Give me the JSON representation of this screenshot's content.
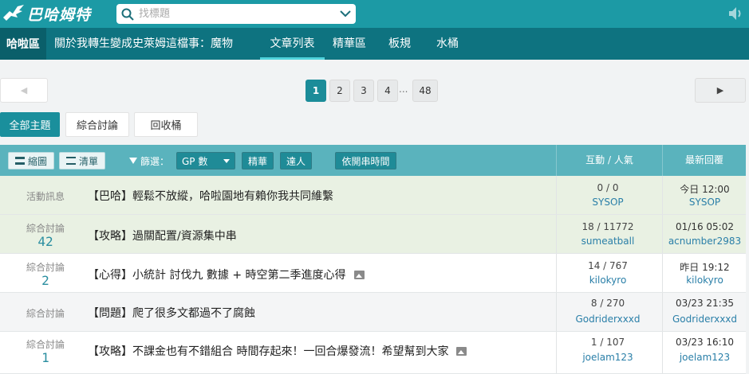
{
  "header": {
    "logo_text": "巴哈姆特",
    "search_placeholder": "找標題",
    "icons": [
      "dragon-logo-icon",
      "search-icon",
      "chevron-down-icon",
      "volume-icon"
    ]
  },
  "subnav": {
    "home": "哈啦區",
    "board_name": "關於我轉生變成史萊姆這檔事：魔物",
    "items": [
      "文章列表",
      "精華區",
      "板規",
      "水桶"
    ]
  },
  "pager": {
    "prev": "◀",
    "next": "▶",
    "pages": [
      "1",
      "2",
      "3",
      "4"
    ],
    "dots": "...",
    "last": "48"
  },
  "categories": [
    "全部主題",
    "綜合討論",
    "回收桶"
  ],
  "toolbar": {
    "thumb_label": "縮圖",
    "list_label": "清單",
    "filter_label": "篩選：",
    "sort_value": "GP 數",
    "essence_label": "精華",
    "expert_label": "達人",
    "time_label": "依開串時間",
    "col_interact": "互動 / 人氣",
    "col_latest": "最新回覆"
  },
  "rows": [
    {
      "category": "活動訊息",
      "count": "",
      "title": "【巴哈】輕鬆不放縱，哈啦園地有賴你我共同維繫",
      "stat": "0 / 0",
      "author": "SYSOP",
      "time": "今日 12:00",
      "reply_user": "SYSOP"
    },
    {
      "category": "綜合討論",
      "count": "42",
      "title": "【攻略】過關配置/資源集中串",
      "stat": "18 / 11772",
      "author": "sumeatball",
      "time": "01/16 05:02",
      "reply_user": "acnumber2983"
    },
    {
      "category": "綜合討論",
      "count": "2",
      "title": "【心得】小統計 討伐九 數據 + 時空第二季進度心得",
      "stat": "14 / 767",
      "author": "kilokyro",
      "time": "昨日 19:12",
      "reply_user": "kilokyro"
    },
    {
      "category": "綜合討論",
      "count": "",
      "title": "【問題】爬了很多文都過不了腐蝕",
      "stat": "8 / 270",
      "author": "Godriderxxxd",
      "time": "03/23 21:35",
      "reply_user": "Godriderxxxd"
    },
    {
      "category": "綜合討論",
      "count": "1",
      "title": "【攻略】不課金也有不錯組合 時間存起來！一回合爆發流！希望幫到大家",
      "stat": "1 / 107",
      "author": "joelam123",
      "time": "03/23 16:10",
      "reply_user": "joelam123"
    }
  ]
}
